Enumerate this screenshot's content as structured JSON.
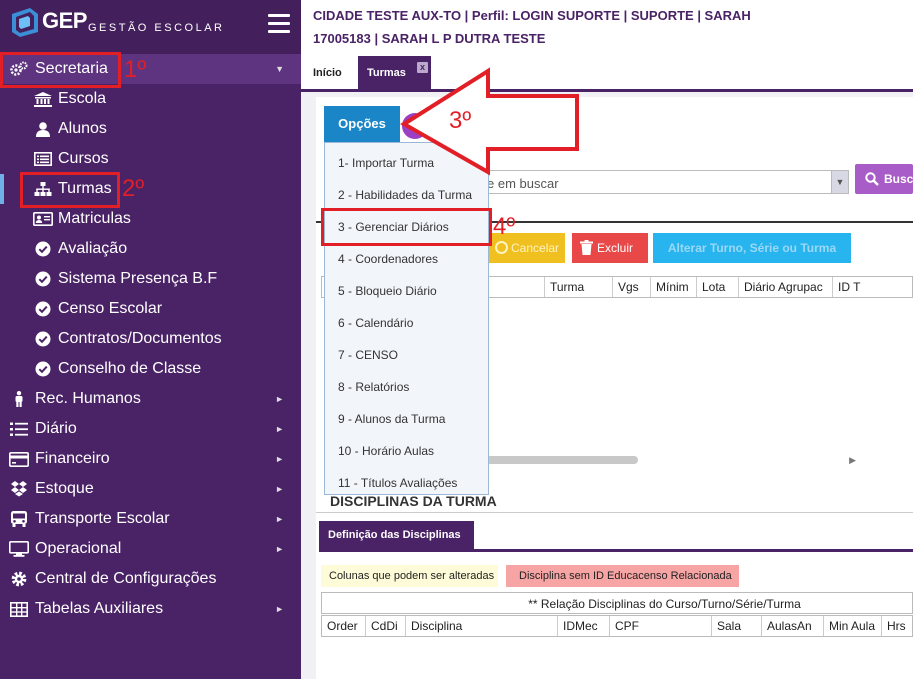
{
  "app": {
    "logo_text": "GEP",
    "logo_sub": "GESTÃO ESCOLAR"
  },
  "header": {
    "line1": "CIDADE TESTE AUX-TO | Perfil: LOGIN SUPORTE | SUPORTE | SARAH",
    "line2": "17005183 | SARAH L P DUTRA TESTE"
  },
  "tabs": [
    {
      "label": "Início"
    },
    {
      "label": "Turmas",
      "close": "x"
    }
  ],
  "sidebar": {
    "top_items": [
      {
        "label": "Secretaria",
        "icon": "gears-icon",
        "arrow": "▼"
      },
      {
        "label": "Rec. Humanos",
        "icon": "person-icon",
        "arrow": "►"
      },
      {
        "label": "Diário",
        "icon": "list-icon",
        "arrow": "►"
      },
      {
        "label": "Financeiro",
        "icon": "credit-card-icon",
        "arrow": "►"
      },
      {
        "label": "Estoque",
        "icon": "dropbox-icon",
        "arrow": "►"
      },
      {
        "label": "Transporte Escolar",
        "icon": "bus-icon",
        "arrow": "►"
      },
      {
        "label": "Operacional",
        "icon": "monitor-icon",
        "arrow": "►"
      },
      {
        "label": "Central de Configurações",
        "icon": "gear-icon",
        "arrow": ""
      },
      {
        "label": "Tabelas Auxiliares",
        "icon": "table-icon",
        "arrow": "►"
      }
    ],
    "sub_items": [
      {
        "label": "Escola",
        "icon": "bank-icon"
      },
      {
        "label": "Alunos",
        "icon": "user-icon"
      },
      {
        "label": "Cursos",
        "icon": "list-alt-icon"
      },
      {
        "label": "Turmas",
        "icon": "sitemap-icon"
      },
      {
        "label": "Matriculas",
        "icon": "id-card-icon"
      },
      {
        "label": "Avaliação",
        "icon": "check-circle-icon"
      },
      {
        "label": "Sistema Presença B.F",
        "icon": "check-circle-icon"
      },
      {
        "label": "Censo Escolar",
        "icon": "check-circle-icon"
      },
      {
        "label": "Contratos/Documentos",
        "icon": "check-circle-icon"
      },
      {
        "label": "Conselho de Classe",
        "icon": "check-circle-icon"
      }
    ]
  },
  "toolbar": {
    "opcoes_label": "Opções",
    "search_placeholder": "e em buscar",
    "search_drop": "▼",
    "search_button": "Busca",
    "cancel_label": "Cancelar",
    "delete_label": "Excluir",
    "alter_label": "Alterar Turno, Série ou Turma"
  },
  "turmas_grid": {
    "columns": [
      "Turma",
      "Vgs",
      "Mínim",
      "Lota",
      "Diário Agrupac",
      "ID T"
    ]
  },
  "dropdown": {
    "items": [
      "1- Importar Turma",
      "2 - Habilidades da Turma",
      "3 - Gerenciar Diários",
      "4 - Coordenadores",
      "5 - Bloqueio Diário",
      "6 - Calendário",
      "7 - CENSO",
      "8 - Relatórios",
      "9 - Alunos da Turma",
      "10 - Horário Aulas",
      "11 - Títulos Avaliações"
    ]
  },
  "disciplinas": {
    "section_title": "DISCIPLINAS DA TURMA",
    "tab_label": "Definição das Disciplinas",
    "legend_editable": "Colunas que podem ser alteradas",
    "legend_no_id": "Disciplina sem ID Educacenso Relacionada",
    "relation_header": "** Relação Disciplinas do Curso/Turno/Série/Turma",
    "columns": [
      "Order",
      "CdDi",
      "Disciplina",
      "IDMec",
      "CPF",
      "Sala",
      "AulasAn",
      "Min Aula",
      "Hrs"
    ]
  },
  "annotations": {
    "step1": "1º",
    "step2": "2º",
    "step3": "3º",
    "step4": "4º",
    "color": "#e21f26"
  }
}
